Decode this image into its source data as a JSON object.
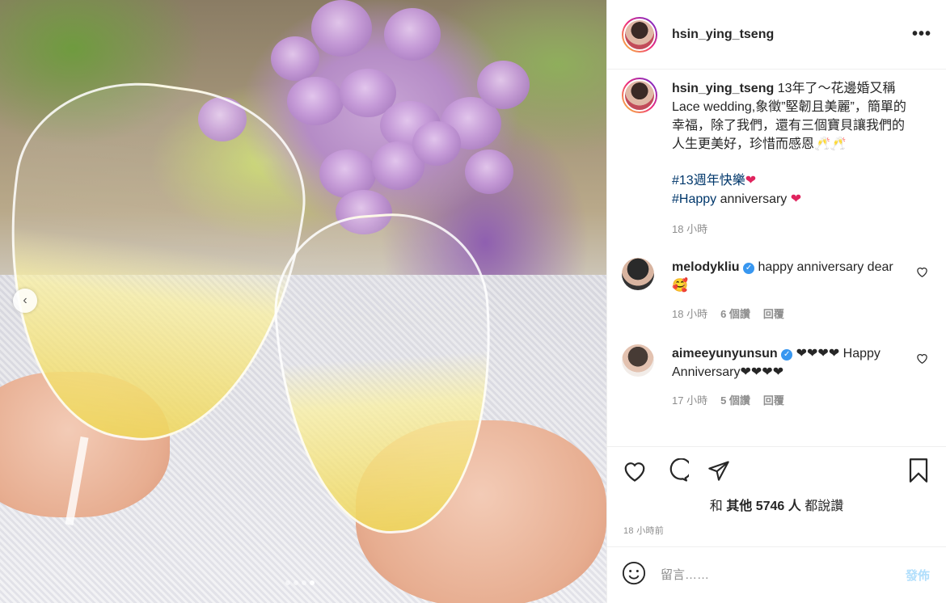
{
  "post": {
    "author": "hsin_ying_tseng",
    "more_label": "•••"
  },
  "photo": {
    "prev_glyph": "‹",
    "carousel_count": 4,
    "carousel_active_index": 3
  },
  "caption": {
    "username": "hsin_ying_tseng",
    "text": "13年了～花邊婚又稱Lace wedding,象徵”堅韌且美麗”，簡單的幸福，除了我們，還有三個寶貝讓我們的人生更美好，珍惜而感恩🥂🥂",
    "hashtag1": "#13週年快樂",
    "hashtag1_emoji": "❤",
    "hashtag2": "#Happy",
    "hashtag2_rest": " anniversary ",
    "hashtag2_emoji": "❤",
    "time": "18 小時"
  },
  "comments": [
    {
      "username": "melodykliu",
      "verified_glyph": "✓",
      "text": " happy anniversary dear 🥰",
      "time": "18 小時",
      "likes": "6 個讚",
      "reply": "回覆",
      "like_icon": "heart-outline"
    },
    {
      "username": "aimeeyunyunsun",
      "verified_glyph": "✓",
      "text": " ❤❤❤❤ Happy Anniversary❤❤❤❤",
      "time": "17 小時",
      "likes": "5 個讚",
      "reply": "回覆",
      "like_icon": "heart-outline"
    }
  ],
  "likes": {
    "prefix": "和 ",
    "others": "其他 5746 人",
    "suffix": " 都說讚"
  },
  "posted_ago": "18 小時前",
  "add_comment": {
    "placeholder": "留言……",
    "post_label": "發佈",
    "emoji_icon": "smiley-icon"
  },
  "colors": {
    "verified_blue": "#3897f0",
    "post_button_disabled": "#b2dffc",
    "hashtag": "#00376b",
    "heart_red": "#e0245e"
  }
}
